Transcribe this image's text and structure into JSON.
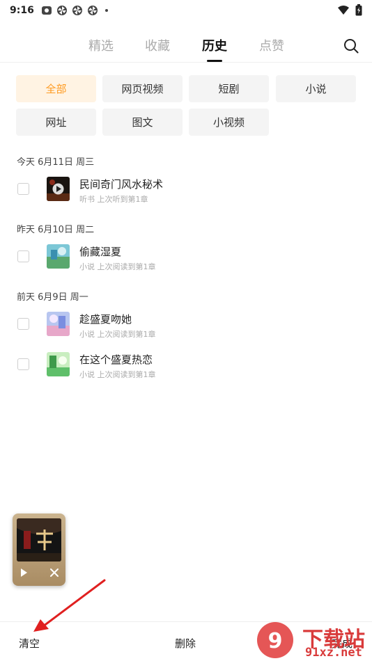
{
  "status_bar": {
    "time": "9:16"
  },
  "tabs": [
    {
      "label": "精选",
      "active": false
    },
    {
      "label": "收藏",
      "active": false
    },
    {
      "label": "历史",
      "active": true
    },
    {
      "label": "点赞",
      "active": false
    }
  ],
  "filters": [
    {
      "label": "全部",
      "active": true
    },
    {
      "label": "网页视频",
      "active": false
    },
    {
      "label": "短剧",
      "active": false
    },
    {
      "label": "小说",
      "active": false
    },
    {
      "label": "网址",
      "active": false
    },
    {
      "label": "图文",
      "active": false
    },
    {
      "label": "小视频",
      "active": false
    }
  ],
  "groups": [
    {
      "date": "今天 6月11日 周三",
      "items": [
        {
          "title": "民间奇门风水秘术",
          "subtitle": "听书 上次听到第1章",
          "checked": false
        }
      ]
    },
    {
      "date": "昨天 6月10日 周二",
      "items": [
        {
          "title": "偷藏湿夏",
          "subtitle": "小说 上次阅读到第1章",
          "checked": false
        }
      ]
    },
    {
      "date": "前天 6月9日 周一",
      "items": [
        {
          "title": "趁盛夏吻她",
          "subtitle": "小说 上次阅读到第1章",
          "checked": false
        },
        {
          "title": "在这个盛夏热恋",
          "subtitle": "小说 上次阅读到第1章",
          "checked": false
        }
      ]
    }
  ],
  "bottom_bar": {
    "clear_label": "清空",
    "delete_label": "删除",
    "done_label": "完成"
  },
  "watermark": {
    "brand": "下载站",
    "url": "91xz.net"
  },
  "colors": {
    "accent": "#ff9a1f",
    "chip_bg": "#f4f4f4",
    "chip_active_bg": "#fff3e3",
    "arrow": "#e02020"
  }
}
